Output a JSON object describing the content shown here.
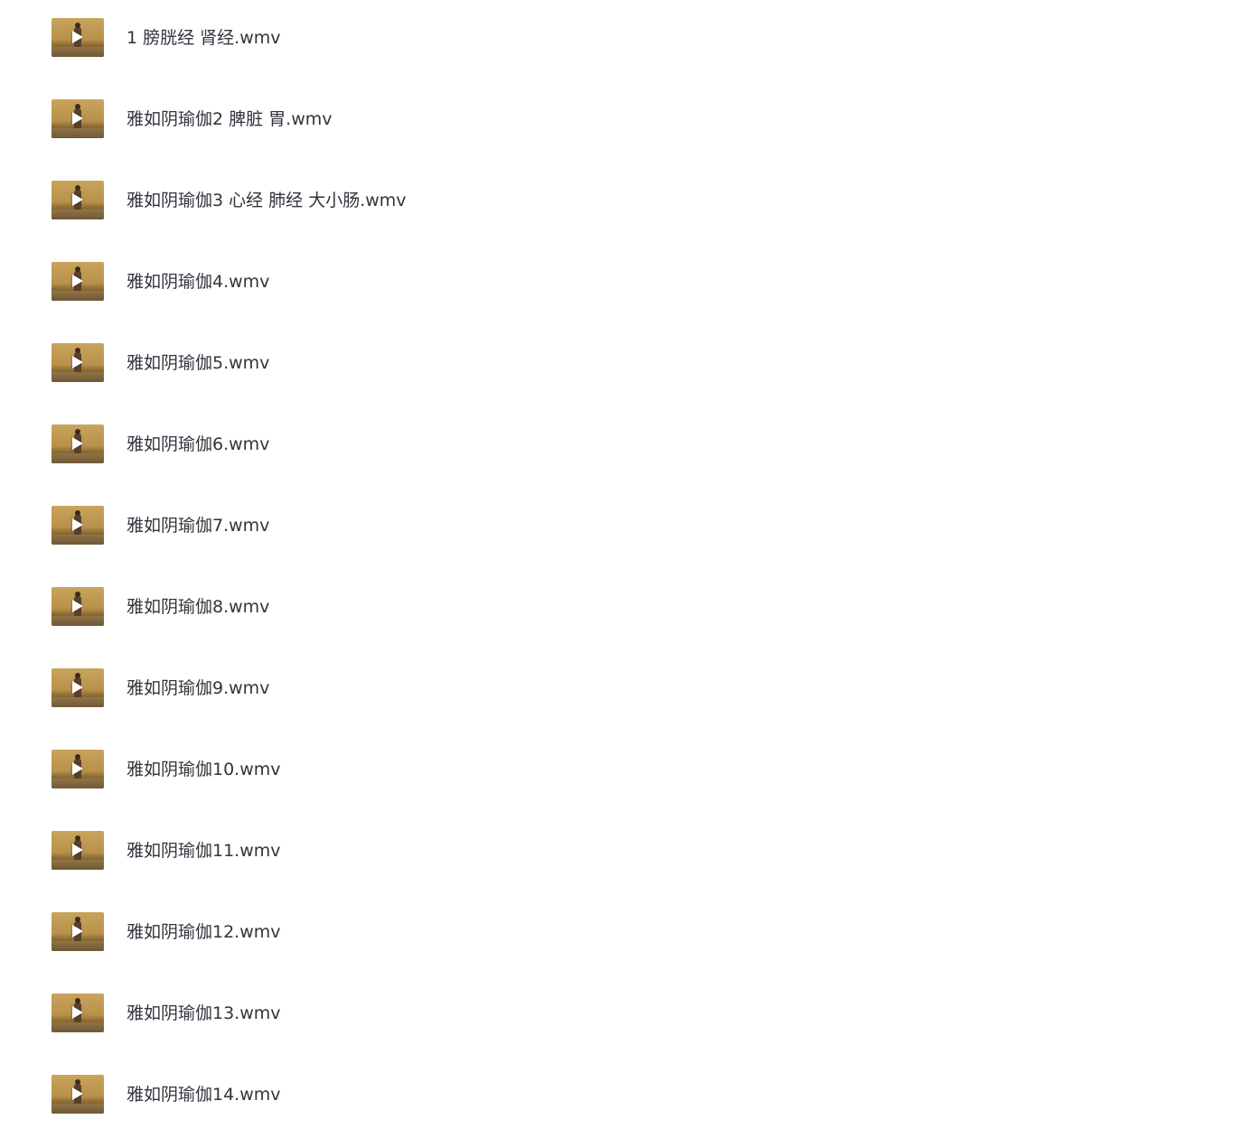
{
  "files": [
    {
      "name": "1 膀胱经 肾经.wmv",
      "icon": "video-thumbnail-icon"
    },
    {
      "name": "雅如阴瑜伽2 脾脏 胃.wmv",
      "icon": "video-thumbnail-icon"
    },
    {
      "name": "雅如阴瑜伽3 心经 肺经 大小肠.wmv",
      "icon": "video-thumbnail-icon"
    },
    {
      "name": "雅如阴瑜伽4.wmv",
      "icon": "video-thumbnail-icon"
    },
    {
      "name": "雅如阴瑜伽5.wmv",
      "icon": "video-thumbnail-icon"
    },
    {
      "name": "雅如阴瑜伽6.wmv",
      "icon": "video-thumbnail-icon"
    },
    {
      "name": "雅如阴瑜伽7.wmv",
      "icon": "video-thumbnail-icon"
    },
    {
      "name": "雅如阴瑜伽8.wmv",
      "icon": "video-thumbnail-icon"
    },
    {
      "name": "雅如阴瑜伽9.wmv",
      "icon": "video-thumbnail-icon"
    },
    {
      "name": "雅如阴瑜伽10.wmv",
      "icon": "video-thumbnail-icon"
    },
    {
      "name": "雅如阴瑜伽11.wmv",
      "icon": "video-thumbnail-icon"
    },
    {
      "name": "雅如阴瑜伽12.wmv",
      "icon": "video-thumbnail-icon"
    },
    {
      "name": "雅如阴瑜伽13.wmv",
      "icon": "video-thumbnail-icon"
    },
    {
      "name": "雅如阴瑜伽14.wmv",
      "icon": "video-thumbnail-icon"
    }
  ],
  "colors": {
    "text": "#33333d",
    "thumbnail_base": "#c9a45c",
    "play_icon": "#ffffff"
  }
}
